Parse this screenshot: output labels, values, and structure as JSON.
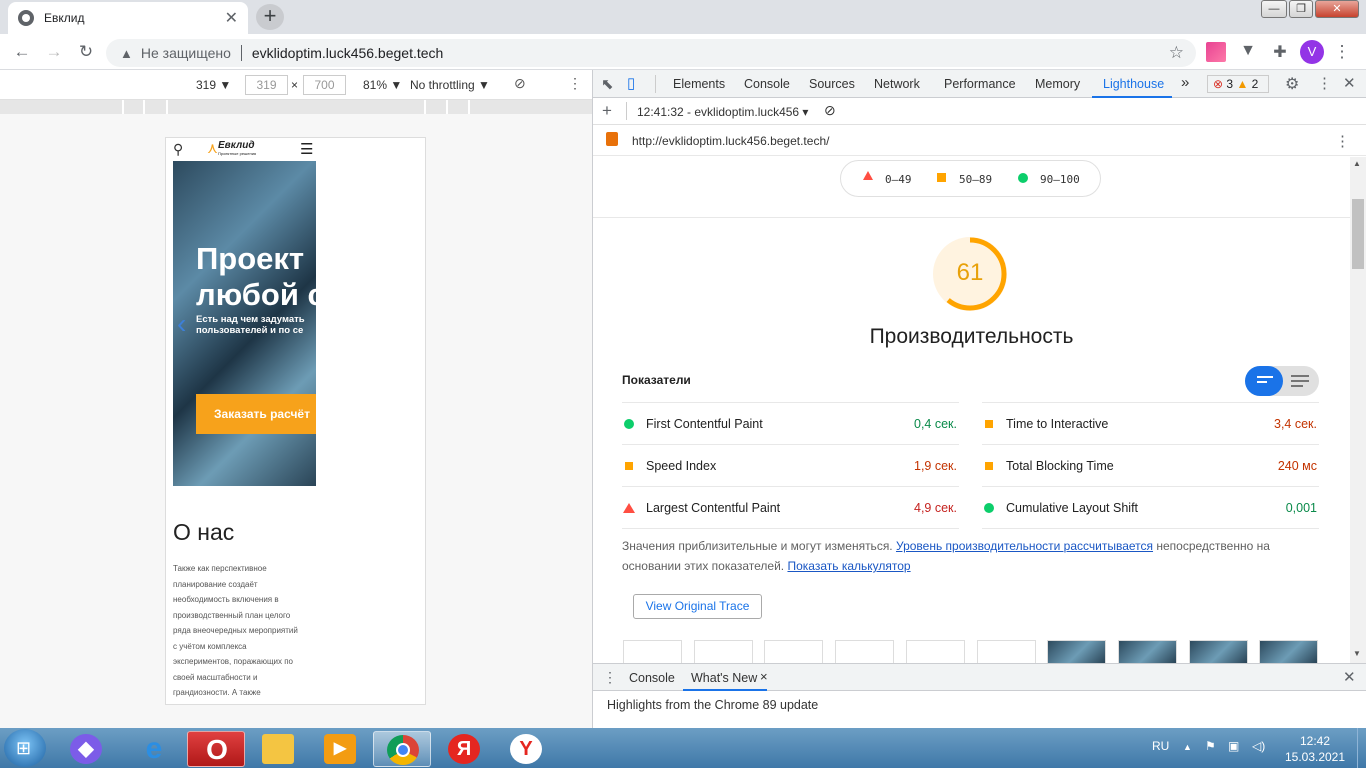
{
  "browser": {
    "tab_title": "Евклид",
    "security_label": "Не защищено",
    "url": "evklidoptim.luck456.beget.tech",
    "avatar_letter": "V"
  },
  "device_toolbar": {
    "device_width_select": "319 ▼",
    "width": "319",
    "height": "700",
    "times": "×",
    "zoom": "81% ▼",
    "throttling": "No throttling ▼"
  },
  "site": {
    "logo_text": "Евклид",
    "logo_sub": "Проектные решения",
    "hero_title_line1": "Проект",
    "hero_title_line2": "любой с",
    "hero_sub_line1": "Есть над чем задумать",
    "hero_sub_line2": "пользователей и по се",
    "hero_button": "Заказать расчёт",
    "about_title": "О нас",
    "about_lines": [
      "Также как перспективное",
      "планирование создаёт",
      "необходимость включения в",
      "производственный план целого",
      "ряда внеочередных мероприятий",
      "с учётом комплекса",
      "экспериментов, поражающих по",
      "своей масштабности и",
      "грандиозности. А также"
    ]
  },
  "devtools": {
    "tabs": [
      "Elements",
      "Console",
      "Sources",
      "Network",
      "Performance",
      "Memory",
      "Lighthouse"
    ],
    "more": "»",
    "errors": "3",
    "warnings": "2",
    "lh_time": "12:41:32 - evklidoptim.luck456 ▾",
    "report_url": "http://evklidoptim.luck456.beget.tech/",
    "legend": {
      "red": "0–49",
      "orange": "50–89",
      "green": "90–100"
    },
    "score": "61",
    "score_fraction": 0.61,
    "category_title": "Производительность",
    "metrics_heading": "Показатели",
    "metrics": [
      {
        "name": "First Contentful Paint",
        "value": "0,4 сек.",
        "status": "green"
      },
      {
        "name": "Time to Interactive",
        "value": "3,4 сек.",
        "status": "orange"
      },
      {
        "name": "Speed Index",
        "value": "1,9 сек.",
        "status": "orange"
      },
      {
        "name": "Total Blocking Time",
        "value": "240 мс",
        "status": "orange"
      },
      {
        "name": "Largest Contentful Paint",
        "value": "4,9 сек.",
        "status": "red"
      },
      {
        "name": "Cumulative Layout Shift",
        "value": "0,001",
        "status": "green"
      }
    ],
    "note_text1": "Значения приблизительные и могут изменяться. ",
    "note_link1": "Уровень производительности рассчитывается",
    "note_text2": " непосредственно на основании этих показателей. ",
    "note_link2": "Показать калькулятор",
    "view_trace": "View Original Trace",
    "drawer_tabs": [
      "Console",
      "What's New"
    ],
    "drawer_close": "×",
    "drawer_text": "Highlights from the Chrome 89 update",
    "colors": {
      "accent": "#1a73e8",
      "green": "#0cce6b",
      "orange": "#ffa400",
      "red": "#ff4e42"
    }
  },
  "taskbar": {
    "lang": "RU",
    "time": "12:42",
    "date": "15.03.2021"
  }
}
